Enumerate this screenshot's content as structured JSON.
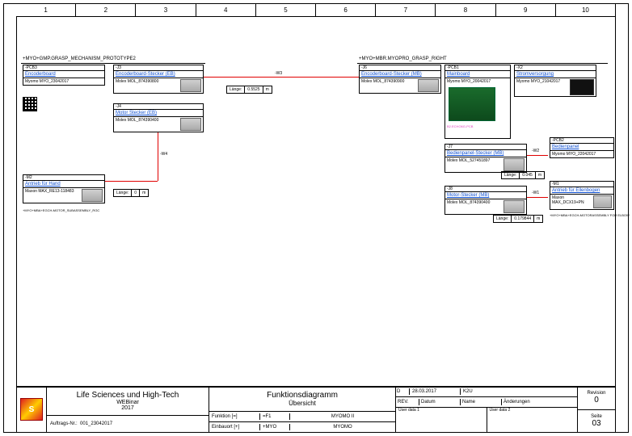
{
  "ruler": [
    "1",
    "2",
    "3",
    "4",
    "5",
    "6",
    "7",
    "8",
    "9",
    "10"
  ],
  "groups": {
    "left": "+MYO+GMP.GRASP_MECHANISM_PROTOTYPE2",
    "right": "+MYO+MBR.MYOPRO_GRASP_RIGHT",
    "motor_assy": "+MYO+MBA+EGCH-MOTOR_SUBASSEMBLY_RGC"
  },
  "blocks": {
    "pcb3": {
      "tag": "-PCB3",
      "title": "Encoderboard",
      "spec": "Myomo MYO_23042017"
    },
    "j3": {
      "tag": "-J3",
      "title": "Encoderboard-Stecker (EB)",
      "spec": "Molex MOL_874390800"
    },
    "j4": {
      "tag": "-J4",
      "title": "Motor Stecker (EB)",
      "spec": "Molex MOL_874390400"
    },
    "m2": {
      "tag": "-M2",
      "title": "Antrieb für Hand",
      "spec": "Maxon MAX_RE13-118483"
    },
    "j6": {
      "tag": "-J6",
      "title": "Encoderboard-Stecker (MB)",
      "spec": "Molex MOL_874390900"
    },
    "pcb1": {
      "tag": "-PCB1",
      "title": "Mainboard",
      "spec": "Myomo MYO_20042017",
      "pink": "B2.ECHO6G-PCB"
    },
    "x2": {
      "tag": "-X2",
      "title": "Stromversorgung",
      "spec": "Myomo MYO_21042017"
    },
    "j7": {
      "tag": "-J7",
      "title": "Bedienpanel-Stecker (MB)",
      "spec": "Molex MOL_527451897"
    },
    "j8": {
      "tag": "-J8",
      "title": "Motor-Stecker (MB)",
      "spec": "Molex MOL_874390400"
    },
    "pcb2": {
      "tag": "-PCB2",
      "title": "Bedienpanel",
      "spec": "Myomo MYO_22042017"
    },
    "m1": {
      "tag": "-M1",
      "title": "Antrieb für Ellenbogen",
      "spec": "Maxon MAX_DCX19+PN"
    },
    "motorassy": {
      "label": "+MYO+MBA+EGCH-MOTORASSEMBLY FOR ELBOW"
    }
  },
  "wires": {
    "w3": {
      "label": "-W3",
      "len": "0.5525",
      "unit": "m"
    },
    "w4": {
      "label": "-W4",
      "len": "0",
      "unit": "m"
    },
    "w2": {
      "label": "-W2",
      "len": "0.045",
      "unit": "m"
    },
    "w1": {
      "label": "-W1",
      "len": "0.179844",
      "unit": "m"
    }
  },
  "title": {
    "company": "Life Sciences und High-Tech",
    "sub1": "WEBinar",
    "sub2": "2017",
    "doc_title": "Funktionsdiagramm",
    "doc_sub": "Übersicht",
    "auftrag_lbl": "Auftrags-Nr.:",
    "auftrag": "001_23042017",
    "funktion_lbl": "Funktion [=]",
    "funktion": "=F1",
    "funktion_name": "MYOMO II",
    "einbauort_lbl": "Einbauort [+]",
    "einbauort": "+MYO",
    "einbauort_name": "MYOMO",
    "date_d": "D",
    "date": "28.03.2017",
    "date_by": "K2U",
    "rev_lbl": "REV.",
    "datum_lbl": "Datum",
    "name_lbl": "Name",
    "aend_lbl": "Änderungen",
    "ud1": "User data 1",
    "ud2": "User data 2",
    "revision_lbl": "Revision",
    "revision": "0",
    "seite_lbl": "Seite",
    "seite": "03"
  }
}
